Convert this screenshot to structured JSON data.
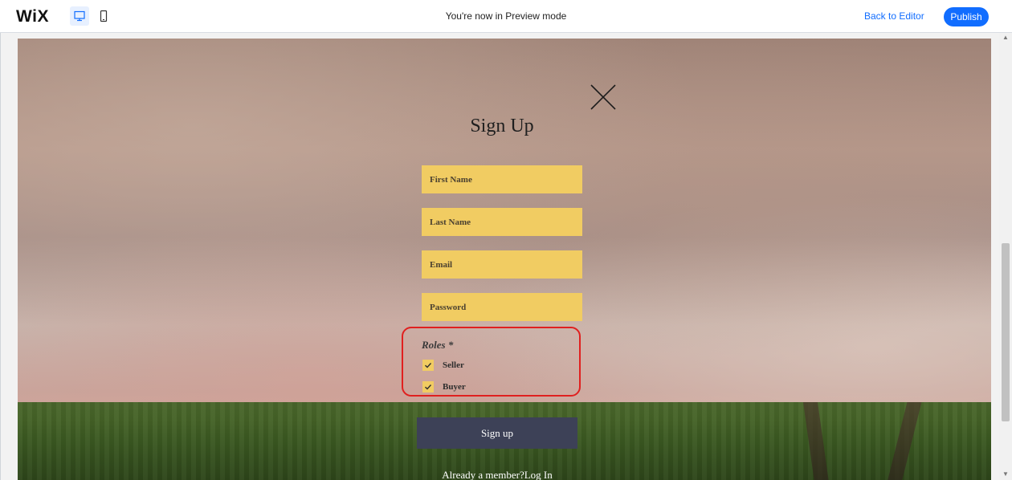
{
  "topbar": {
    "logo": "WiX",
    "preview_text": "You're now in Preview mode",
    "back_label": "Back to Editor",
    "publish_label": "Publish",
    "desktop_icon": "desktop-icon",
    "mobile_icon": "mobile-icon"
  },
  "form": {
    "title": "Sign Up",
    "fields": {
      "first_name": "First Name",
      "last_name": "Last Name",
      "email": "Email",
      "password": "Password"
    },
    "roles_label": "Roles *",
    "roles": [
      {
        "label": "Seller",
        "checked": true
      },
      {
        "label": "Buyer",
        "checked": true
      }
    ],
    "submit_label": "Sign up",
    "login_text": "Already a member?Log In",
    "close_icon": "close-icon"
  },
  "colors": {
    "accent": "#116dff",
    "field": "#f1cc62",
    "button": "#3d4157",
    "highlight": "#e0201f"
  }
}
